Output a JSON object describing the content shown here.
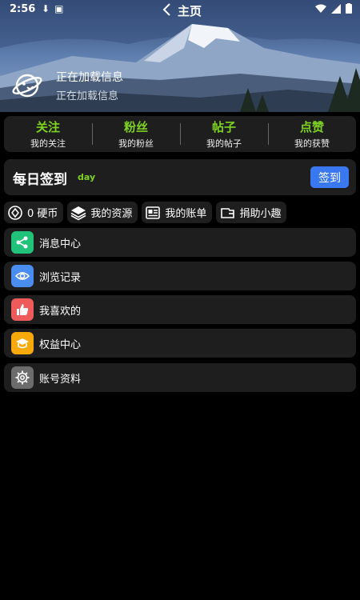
{
  "status": {
    "time": "2:56"
  },
  "nav": {
    "title": "主页"
  },
  "user": {
    "name": "正在加载信息",
    "subtitle": "正在加载信息"
  },
  "stats": [
    {
      "value": "关注",
      "label": "我的关注"
    },
    {
      "value": "粉丝",
      "label": "我的粉丝"
    },
    {
      "value": "帖子",
      "label": "我的帖子"
    },
    {
      "value": "点赞",
      "label": "我的获赞"
    }
  ],
  "checkin": {
    "title": "每日签到",
    "tag": "day",
    "button": "签到"
  },
  "chips": [
    {
      "label": "0 硬币",
      "icon": "coin-icon"
    },
    {
      "label": "我的资源",
      "icon": "layers-icon"
    },
    {
      "label": "我的账单",
      "icon": "bill-icon"
    },
    {
      "label": "捐助小趣",
      "icon": "wallet-icon"
    }
  ],
  "menu": [
    {
      "label": "消息中心",
      "icon": "share-icon",
      "color": "#21c27a"
    },
    {
      "label": "浏览记录",
      "icon": "eye-icon",
      "color": "#4a8df0"
    },
    {
      "label": "我喜欢的",
      "icon": "thumb-up-icon",
      "color": "#ef5b5b"
    },
    {
      "label": "权益中心",
      "icon": "graduation-cap-icon",
      "color": "#f5a90a"
    },
    {
      "label": "账号资料",
      "icon": "gear-icon",
      "color": "#6c6c6c"
    }
  ]
}
